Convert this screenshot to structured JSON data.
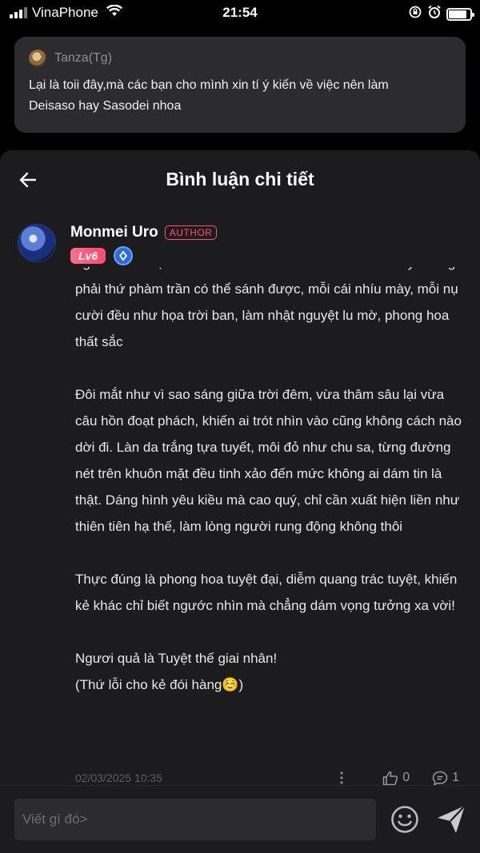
{
  "status": {
    "carrier": "VinaPhone",
    "time": "21:54"
  },
  "post": {
    "author": "Tanza(Tg)",
    "text_lines": [
      "Lại là toii đây,mà các bạn cho mình xin tí ý kiến về việc nên làm",
      "Deisaso hay Sasodei nhoa"
    ]
  },
  "sheet": {
    "title": "Bình luận chi tiết"
  },
  "comment": {
    "author": "Monmei Uro",
    "author_badge": "AUTHOR",
    "level": "Lv6",
    "paragraphs": [
      "người nhìn một lần liền tâm thần chao đảo. Nhan sắc ấy chẳng phải thứ phàm trần có thể sánh được, mỗi cái nhíu mày, mỗi nụ cười đều như họa trời ban, làm nhật nguyệt lu mờ, phong hoa thất sắc",
      "Đôi mắt như vì sao sáng giữa trời đêm, vừa thâm sâu lại vừa câu hồn đoạt phách, khiến ai trót nhìn vào cũng không cách nào dời đi. Làn da trắng tựa tuyết, môi đỏ như chu sa, từng đường nét trên khuôn mặt đều tinh xảo đến mức không ai dám tin là thật. Dáng hình yêu kiều mà cao quý, chỉ cần xuất hiện liền như thiên tiên hạ thế, làm lòng người rung động không thôi",
      "Thực đúng là phong hoa tuyệt đại, diễm quang trác tuyệt, khiến kẻ khác chỉ biết ngước nhìn mà chẳng dám vọng tưởng xa vời!",
      "Ngươi quả là Tuyệt thế giai nhân!",
      "(Thứ lỗi cho kẻ đói hàng☺️)"
    ],
    "date": "02/03/2025 10:35",
    "likes": "0",
    "replies": "1"
  },
  "input": {
    "placeholder": "Viết gì đó>"
  },
  "colors": {
    "accent": "#ff4f7a",
    "background": "#000000",
    "sheet": "#1c1c1e",
    "card": "#2c2c2e"
  },
  "icons": [
    "signal-icon",
    "wifi-icon",
    "rotation-lock-icon",
    "alarm-icon",
    "battery-icon",
    "back-arrow-icon",
    "diamond-icon",
    "more-icon",
    "like-icon",
    "comment-icon",
    "emoji-icon",
    "send-icon"
  ]
}
